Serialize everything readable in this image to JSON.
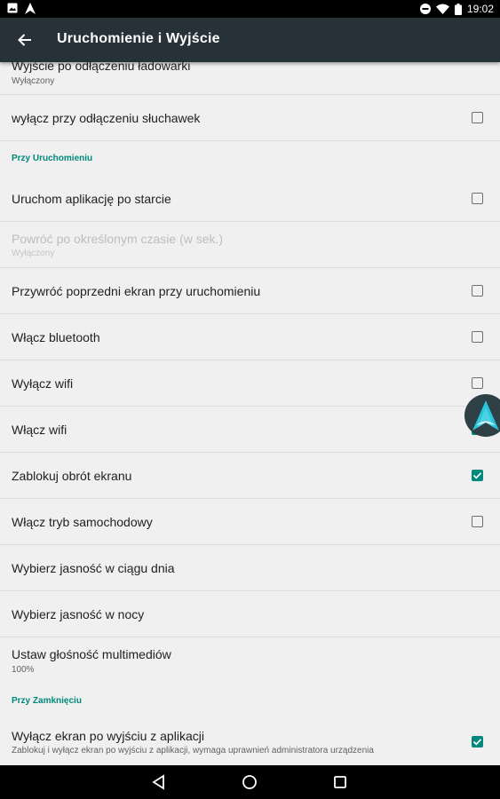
{
  "status_bar": {
    "time": "19:02",
    "left_icons": [
      "image-icon",
      "app-logo-icon"
    ],
    "right_icons": [
      "do-not-disturb-icon",
      "wifi-icon",
      "battery-icon"
    ]
  },
  "app_bar": {
    "title": "Uruchomienie i Wyjście",
    "back_icon": "arrow-back-icon",
    "background": "#263238"
  },
  "accent_color": "#00897b",
  "settings": {
    "exit_on_charger": {
      "label": "Wyjście po odłączeniu ładowarki",
      "summary": "Wyłączony"
    },
    "turn_off_headphones": {
      "label": "wyłącz przy odłączeniu słuchawek",
      "checked": false
    },
    "section_startup": "Przy Uruchomieniu",
    "launch_after_boot": {
      "label": "Uruchom aplikację po starcie",
      "checked": false
    },
    "return_after_time": {
      "label": "Powróć po określonym czasie (w sek.)",
      "summary": "Wyłączony",
      "enabled": false
    },
    "restore_screen": {
      "label": "Przywróć poprzedni ekran przy uruchomieniu",
      "checked": false
    },
    "enable_bluetooth": {
      "label": "Włącz bluetooth",
      "checked": false
    },
    "disable_wifi": {
      "label": "Wyłącz wifi",
      "checked": false
    },
    "enable_wifi": {
      "label": "Włącz wifi",
      "checked": true
    },
    "lock_rotation": {
      "label": "Zablokuj obrót ekranu",
      "checked": true
    },
    "car_mode": {
      "label": "Włącz tryb samochodowy",
      "checked": false
    },
    "brightness_day": {
      "label": "Wybierz jasność w ciągu dnia"
    },
    "brightness_night": {
      "label": "Wybierz jasność w nocy"
    },
    "media_volume": {
      "label": "Ustaw głośność multimediów",
      "summary": "100%"
    },
    "section_shutdown": "Przy Zamknięciu",
    "screen_off_exit": {
      "label": "Wyłącz ekran po wyjściu z aplikacji",
      "summary": "Zablokuj i wyłącz ekran po wyjściu z aplikacji, wymaga uprawnień administratora urządzenia",
      "checked": true
    }
  },
  "fab_icon": "app-logo-icon",
  "nav_bar": {
    "icons": [
      "back-triangle-icon",
      "home-circle-icon",
      "recents-square-icon"
    ]
  }
}
